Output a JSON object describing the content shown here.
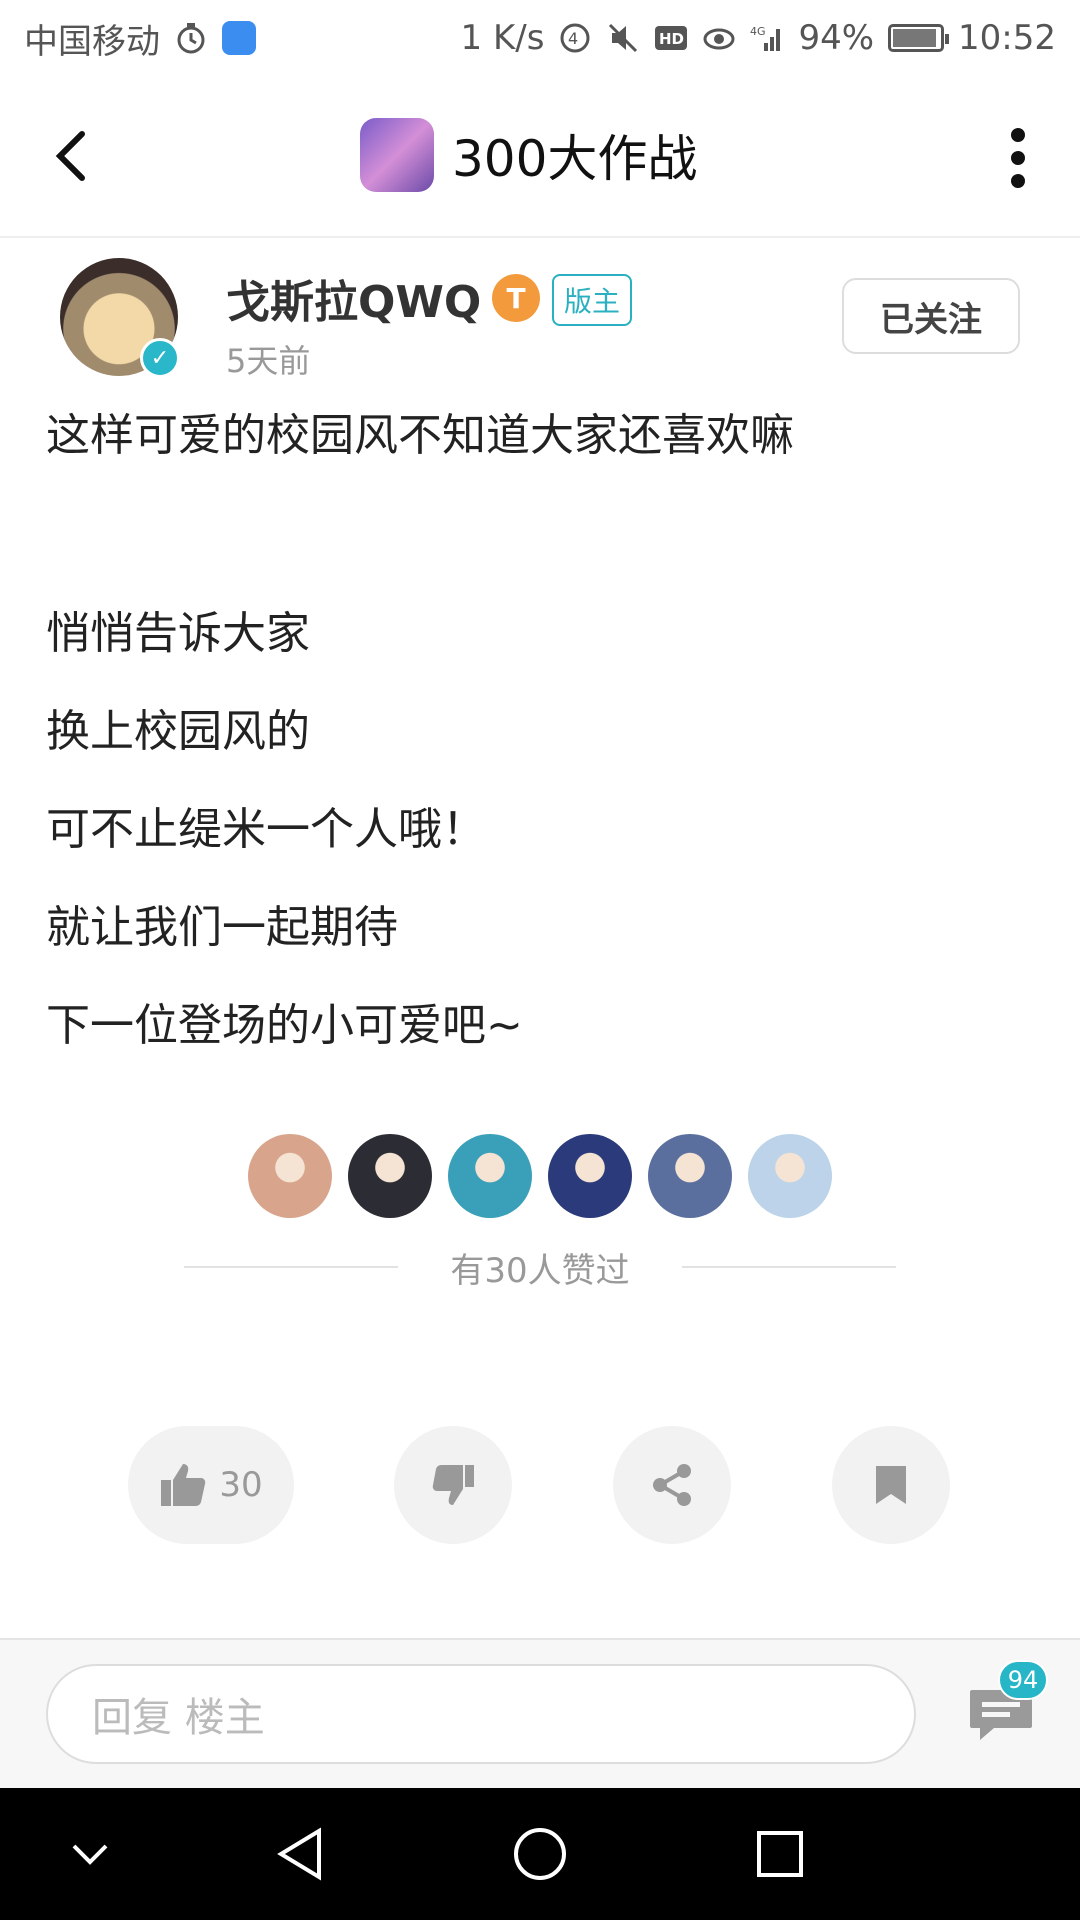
{
  "status_bar": {
    "carrier": "中国移动",
    "speed": "1 K/s",
    "battery": "94%",
    "battery_level": 0.94,
    "time": "10:52"
  },
  "header": {
    "title": "300大作战",
    "back_icon": "chevron-left-icon",
    "more_icon": "more-vertical-icon"
  },
  "author": {
    "name": "戈斯拉QWQ",
    "level_badge": "T",
    "role_badge": "版主",
    "time": "5天前",
    "follow_label": "已关注"
  },
  "post": {
    "lines": [
      "这样可爱的校园风不知道大家还喜欢嘛",
      "",
      "悄悄告诉大家",
      "换上校园风的",
      "可不止缇米一个人哦！",
      "就让我们一起期待",
      "下一位登场的小可爱吧~"
    ]
  },
  "likes": {
    "summary": "有30人赞过",
    "avatar_colors": [
      "#d8a58c",
      "#2c2c34",
      "#3a9fb8",
      "#2b3a7a",
      "#5b6f9e",
      "#bcd3ea"
    ]
  },
  "actions": {
    "like_count": "30"
  },
  "reply": {
    "placeholder": "回复  楼主",
    "comment_count": "94"
  },
  "colors": {
    "accent": "#26b6c7",
    "level_orange": "#f39a3c"
  }
}
